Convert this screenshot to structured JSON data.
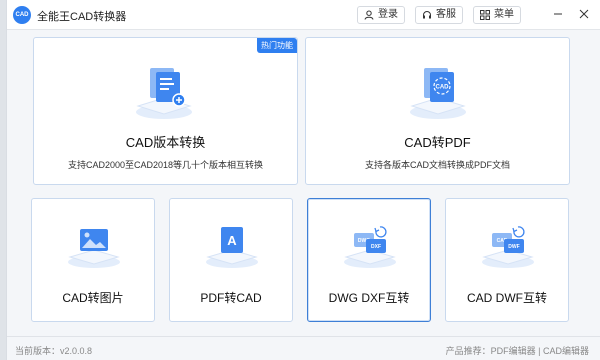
{
  "app": {
    "title": "全能王CAD转换器",
    "logo_text": "CAD"
  },
  "toolbar": {
    "login_label": "登录",
    "service_label": "客服",
    "menu_label": "菜单"
  },
  "cards": {
    "version": {
      "title": "CAD版本转换",
      "desc": "支持CAD2000至CAD2018等几十个版本相互转换",
      "badge": "热门功能"
    },
    "to_pdf": {
      "title": "CAD转PDF",
      "desc": "支持各版本CAD文档转换成PDF文档",
      "icon_text": "CAD"
    },
    "to_image": {
      "title": "CAD转图片"
    },
    "pdf_to_cad": {
      "title": "PDF转CAD",
      "icon_text": "A"
    },
    "dwg_dxf": {
      "title": "DWG DXF互转",
      "icon_text_a": "DWG",
      "icon_text_b": "DXF"
    },
    "cad_dwf": {
      "title": "CAD DWF互转",
      "icon_text_a": "CAD",
      "icon_text_b": "DWF"
    }
  },
  "footer": {
    "version": "当前版本：v2.0.0.8",
    "recommend": "产品推荐：PDF编辑器 | CAD编辑器"
  },
  "colors": {
    "accent": "#2f7ff0",
    "card_border": "#c9d9ee"
  }
}
